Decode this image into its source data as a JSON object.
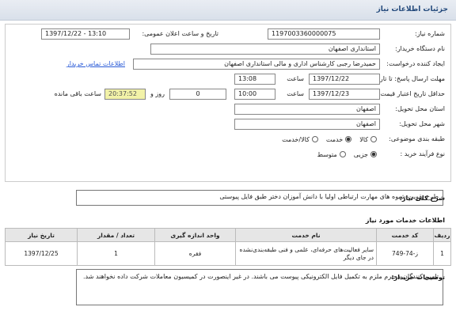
{
  "header": {
    "title": "جزئیات اطلاعات نیاز"
  },
  "form": {
    "need_number_label": "شماره نیاز:",
    "need_number": "1197003360000075",
    "announce_label": "تاریخ و ساعت اعلان عمومی:",
    "announce_value": "1397/12/22 - 13:10",
    "buyer_org_label": "نام دستگاه خریدار:",
    "buyer_org": "استانداری اصفهان",
    "creator_label": "ایجاد کننده درخواست:",
    "creator": "حمیدرضا رجبی کارشناس اداری و مالی استانداری اصفهان",
    "contact_link": "اطلاعات تماس خریدار",
    "reply_deadline_label": "مهلت ارسال پاسخ: تا تاریخ:",
    "reply_date": "1397/12/22",
    "time_label": "ساعت",
    "reply_time": "13:08",
    "validity_label": "حداقل تاریخ اعتبار قیمت: تا تاریخ:",
    "validity_date": "1397/12/23",
    "validity_time": "10:00",
    "days_count": "0",
    "day_and_label": "روز و",
    "remaining_time": "20:37:52",
    "remaining_label": "ساعت باقی مانده",
    "delivery_province_label": "استان محل تحویل:",
    "delivery_province": "اصفهان",
    "delivery_city_label": "شهر محل تحویل:",
    "delivery_city": "اصفهان",
    "category_label": "طبقه بندی موضوعی:",
    "category_options": [
      "کالا",
      "خدمت",
      "کالا/خدمت"
    ],
    "category_selected": "خدمت",
    "process_label": "نوع فرآیند خرید :",
    "process_options": [
      "جزیی",
      "متوسط"
    ],
    "process_selected": "جزیی"
  },
  "description": {
    "label": "شرح کلی نیاز:",
    "text": "طرح تقویت شیوه های مهارت ارتباطی اولیا با دانش آموزان دختر طبق فایل پیوستی"
  },
  "services": {
    "section_title": "اطلاعات خدمات مورد نیاز",
    "columns": [
      "ردیف",
      "کد خدمت",
      "نام خدمت",
      "واحد اندازه گیری",
      "تعداد / مقدار",
      "تاریخ نیاز"
    ],
    "rows": [
      [
        "1",
        "ز-74-749",
        "سایر فعالیت‌های حرفه‌ای، علمی و فنی طبقه‌بندی‌نشده در جای دیگر",
        "فقره",
        "1",
        "1397/12/25"
      ]
    ]
  },
  "buyer_notes": {
    "label": "توضیحات خریدار:",
    "text": "تامین کنندگان محترم ملزم به تکمیل فایل الکترونیکی پیوست می باشند. در غیر اینصورت در کمیسیون معاملات شرکت داده نخواهند شد."
  },
  "colors": {
    "header_text": "#244a7c",
    "link": "#2a5bd7",
    "timer_bg": "#f2f2a8"
  }
}
